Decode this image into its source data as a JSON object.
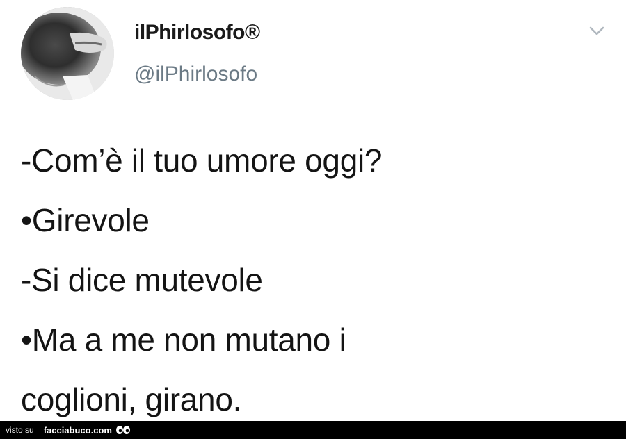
{
  "tweet": {
    "display_name": "ilPhirlosofo®",
    "handle": "@ilPhirlosofo",
    "menu_icon": "chevron-down-icon",
    "avatar_icon": "avatar",
    "lines": [
      "-Com’è il tuo umore oggi?",
      "•Girevole",
      "-Si dice mutevole",
      "•Ma a me non mutano i",
      "coglioni, girano."
    ]
  },
  "footer": {
    "prefix": "visto su",
    "site": "facciabuco.com",
    "logo_icon": "eyes-icon"
  },
  "colors": {
    "background": "#ffffff",
    "text": "#141414",
    "handle": "#6b7a85",
    "chevron": "#b0b8bf",
    "footer_bg": "#000000"
  }
}
